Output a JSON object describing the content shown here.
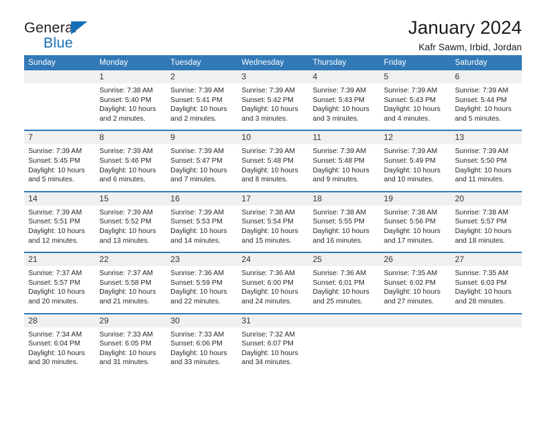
{
  "brand": {
    "name_part1": "General",
    "name_part2": "Blue",
    "triangle_color": "#1470b8"
  },
  "header": {
    "title": "January 2024",
    "subtitle": "Kafr Sawm, Irbid, Jordan"
  },
  "theme": {
    "header_blue": "#3279b7",
    "daynum_gray": "#f0f0f0",
    "text": "#262626"
  },
  "weekday_headers": [
    "Sunday",
    "Monday",
    "Tuesday",
    "Wednesday",
    "Thursday",
    "Friday",
    "Saturday"
  ],
  "weeks": [
    [
      {
        "day": "",
        "sunrise": "",
        "sunset": "",
        "daylight": ""
      },
      {
        "day": "1",
        "sunrise": "Sunrise: 7:38 AM",
        "sunset": "Sunset: 5:40 PM",
        "daylight": "Daylight: 10 hours and 2 minutes."
      },
      {
        "day": "2",
        "sunrise": "Sunrise: 7:39 AM",
        "sunset": "Sunset: 5:41 PM",
        "daylight": "Daylight: 10 hours and 2 minutes."
      },
      {
        "day": "3",
        "sunrise": "Sunrise: 7:39 AM",
        "sunset": "Sunset: 5:42 PM",
        "daylight": "Daylight: 10 hours and 3 minutes."
      },
      {
        "day": "4",
        "sunrise": "Sunrise: 7:39 AM",
        "sunset": "Sunset: 5:43 PM",
        "daylight": "Daylight: 10 hours and 3 minutes."
      },
      {
        "day": "5",
        "sunrise": "Sunrise: 7:39 AM",
        "sunset": "Sunset: 5:43 PM",
        "daylight": "Daylight: 10 hours and 4 minutes."
      },
      {
        "day": "6",
        "sunrise": "Sunrise: 7:39 AM",
        "sunset": "Sunset: 5:44 PM",
        "daylight": "Daylight: 10 hours and 5 minutes."
      }
    ],
    [
      {
        "day": "7",
        "sunrise": "Sunrise: 7:39 AM",
        "sunset": "Sunset: 5:45 PM",
        "daylight": "Daylight: 10 hours and 5 minutes."
      },
      {
        "day": "8",
        "sunrise": "Sunrise: 7:39 AM",
        "sunset": "Sunset: 5:46 PM",
        "daylight": "Daylight: 10 hours and 6 minutes."
      },
      {
        "day": "9",
        "sunrise": "Sunrise: 7:39 AM",
        "sunset": "Sunset: 5:47 PM",
        "daylight": "Daylight: 10 hours and 7 minutes."
      },
      {
        "day": "10",
        "sunrise": "Sunrise: 7:39 AM",
        "sunset": "Sunset: 5:48 PM",
        "daylight": "Daylight: 10 hours and 8 minutes."
      },
      {
        "day": "11",
        "sunrise": "Sunrise: 7:39 AM",
        "sunset": "Sunset: 5:48 PM",
        "daylight": "Daylight: 10 hours and 9 minutes."
      },
      {
        "day": "12",
        "sunrise": "Sunrise: 7:39 AM",
        "sunset": "Sunset: 5:49 PM",
        "daylight": "Daylight: 10 hours and 10 minutes."
      },
      {
        "day": "13",
        "sunrise": "Sunrise: 7:39 AM",
        "sunset": "Sunset: 5:50 PM",
        "daylight": "Daylight: 10 hours and 11 minutes."
      }
    ],
    [
      {
        "day": "14",
        "sunrise": "Sunrise: 7:39 AM",
        "sunset": "Sunset: 5:51 PM",
        "daylight": "Daylight: 10 hours and 12 minutes."
      },
      {
        "day": "15",
        "sunrise": "Sunrise: 7:39 AM",
        "sunset": "Sunset: 5:52 PM",
        "daylight": "Daylight: 10 hours and 13 minutes."
      },
      {
        "day": "16",
        "sunrise": "Sunrise: 7:39 AM",
        "sunset": "Sunset: 5:53 PM",
        "daylight": "Daylight: 10 hours and 14 minutes."
      },
      {
        "day": "17",
        "sunrise": "Sunrise: 7:38 AM",
        "sunset": "Sunset: 5:54 PM",
        "daylight": "Daylight: 10 hours and 15 minutes."
      },
      {
        "day": "18",
        "sunrise": "Sunrise: 7:38 AM",
        "sunset": "Sunset: 5:55 PM",
        "daylight": "Daylight: 10 hours and 16 minutes."
      },
      {
        "day": "19",
        "sunrise": "Sunrise: 7:38 AM",
        "sunset": "Sunset: 5:56 PM",
        "daylight": "Daylight: 10 hours and 17 minutes."
      },
      {
        "day": "20",
        "sunrise": "Sunrise: 7:38 AM",
        "sunset": "Sunset: 5:57 PM",
        "daylight": "Daylight: 10 hours and 18 minutes."
      }
    ],
    [
      {
        "day": "21",
        "sunrise": "Sunrise: 7:37 AM",
        "sunset": "Sunset: 5:57 PM",
        "daylight": "Daylight: 10 hours and 20 minutes."
      },
      {
        "day": "22",
        "sunrise": "Sunrise: 7:37 AM",
        "sunset": "Sunset: 5:58 PM",
        "daylight": "Daylight: 10 hours and 21 minutes."
      },
      {
        "day": "23",
        "sunrise": "Sunrise: 7:36 AM",
        "sunset": "Sunset: 5:59 PM",
        "daylight": "Daylight: 10 hours and 22 minutes."
      },
      {
        "day": "24",
        "sunrise": "Sunrise: 7:36 AM",
        "sunset": "Sunset: 6:00 PM",
        "daylight": "Daylight: 10 hours and 24 minutes."
      },
      {
        "day": "25",
        "sunrise": "Sunrise: 7:36 AM",
        "sunset": "Sunset: 6:01 PM",
        "daylight": "Daylight: 10 hours and 25 minutes."
      },
      {
        "day": "26",
        "sunrise": "Sunrise: 7:35 AM",
        "sunset": "Sunset: 6:02 PM",
        "daylight": "Daylight: 10 hours and 27 minutes."
      },
      {
        "day": "27",
        "sunrise": "Sunrise: 7:35 AM",
        "sunset": "Sunset: 6:03 PM",
        "daylight": "Daylight: 10 hours and 28 minutes."
      }
    ],
    [
      {
        "day": "28",
        "sunrise": "Sunrise: 7:34 AM",
        "sunset": "Sunset: 6:04 PM",
        "daylight": "Daylight: 10 hours and 30 minutes."
      },
      {
        "day": "29",
        "sunrise": "Sunrise: 7:33 AM",
        "sunset": "Sunset: 6:05 PM",
        "daylight": "Daylight: 10 hours and 31 minutes."
      },
      {
        "day": "30",
        "sunrise": "Sunrise: 7:33 AM",
        "sunset": "Sunset: 6:06 PM",
        "daylight": "Daylight: 10 hours and 33 minutes."
      },
      {
        "day": "31",
        "sunrise": "Sunrise: 7:32 AM",
        "sunset": "Sunset: 6:07 PM",
        "daylight": "Daylight: 10 hours and 34 minutes."
      },
      {
        "day": "",
        "sunrise": "",
        "sunset": "",
        "daylight": ""
      },
      {
        "day": "",
        "sunrise": "",
        "sunset": "",
        "daylight": ""
      },
      {
        "day": "",
        "sunrise": "",
        "sunset": "",
        "daylight": ""
      }
    ]
  ]
}
